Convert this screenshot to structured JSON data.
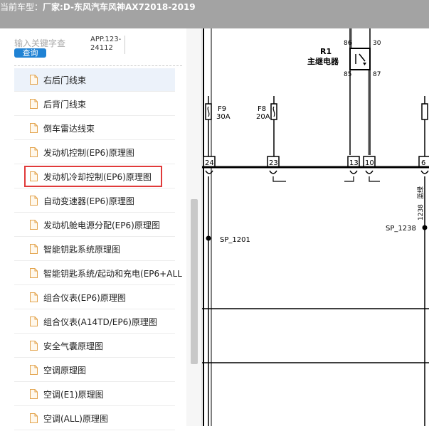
{
  "header": {
    "label": "当前车型：",
    "value": "厂家:D-东风汽车风神AX72018-2019"
  },
  "search": {
    "placeholder": "输入关键字查",
    "button_label": "查询",
    "app_version": "APP.123-24112"
  },
  "doc_list": [
    "右后门线束",
    "后背门线束",
    "倒车雷达线束",
    "发动机控制(EP6)原理图",
    "发动机冷却控制(EP6)原理图",
    "自动变速器(EP6)原理图",
    "发动机舱电源分配(EP6)原理图",
    "智能钥匙系统原理图",
    "智能钥匙系统/起动和充电(EP6+ALL",
    "组合仪表(EP6)原理图",
    "组合仪表(A14TD/EP6)原理图",
    "安全气囊原理图",
    "空调原理图",
    "空调(E1)原理图",
    "空调(ALL)原理图"
  ],
  "diagram": {
    "relay": {
      "name": "R1",
      "desc": "主继电器",
      "pins": [
        "86",
        "30",
        "85",
        "87"
      ]
    },
    "fuses": [
      {
        "name": "F9",
        "rating": "30A"
      },
      {
        "name": "F8",
        "rating": "20A"
      }
    ],
    "connectors": [
      "24",
      "23",
      "13",
      "10",
      "6"
    ],
    "splices": [
      "SP_1201",
      "SP_1238"
    ],
    "wire_labels": [
      "1238",
      "蓝绿"
    ]
  },
  "colors": {
    "topbar": "#a3a3a3",
    "button": "#1f82d4",
    "highlight": "#e03a3a",
    "active_row": "#ecf2fa"
  }
}
